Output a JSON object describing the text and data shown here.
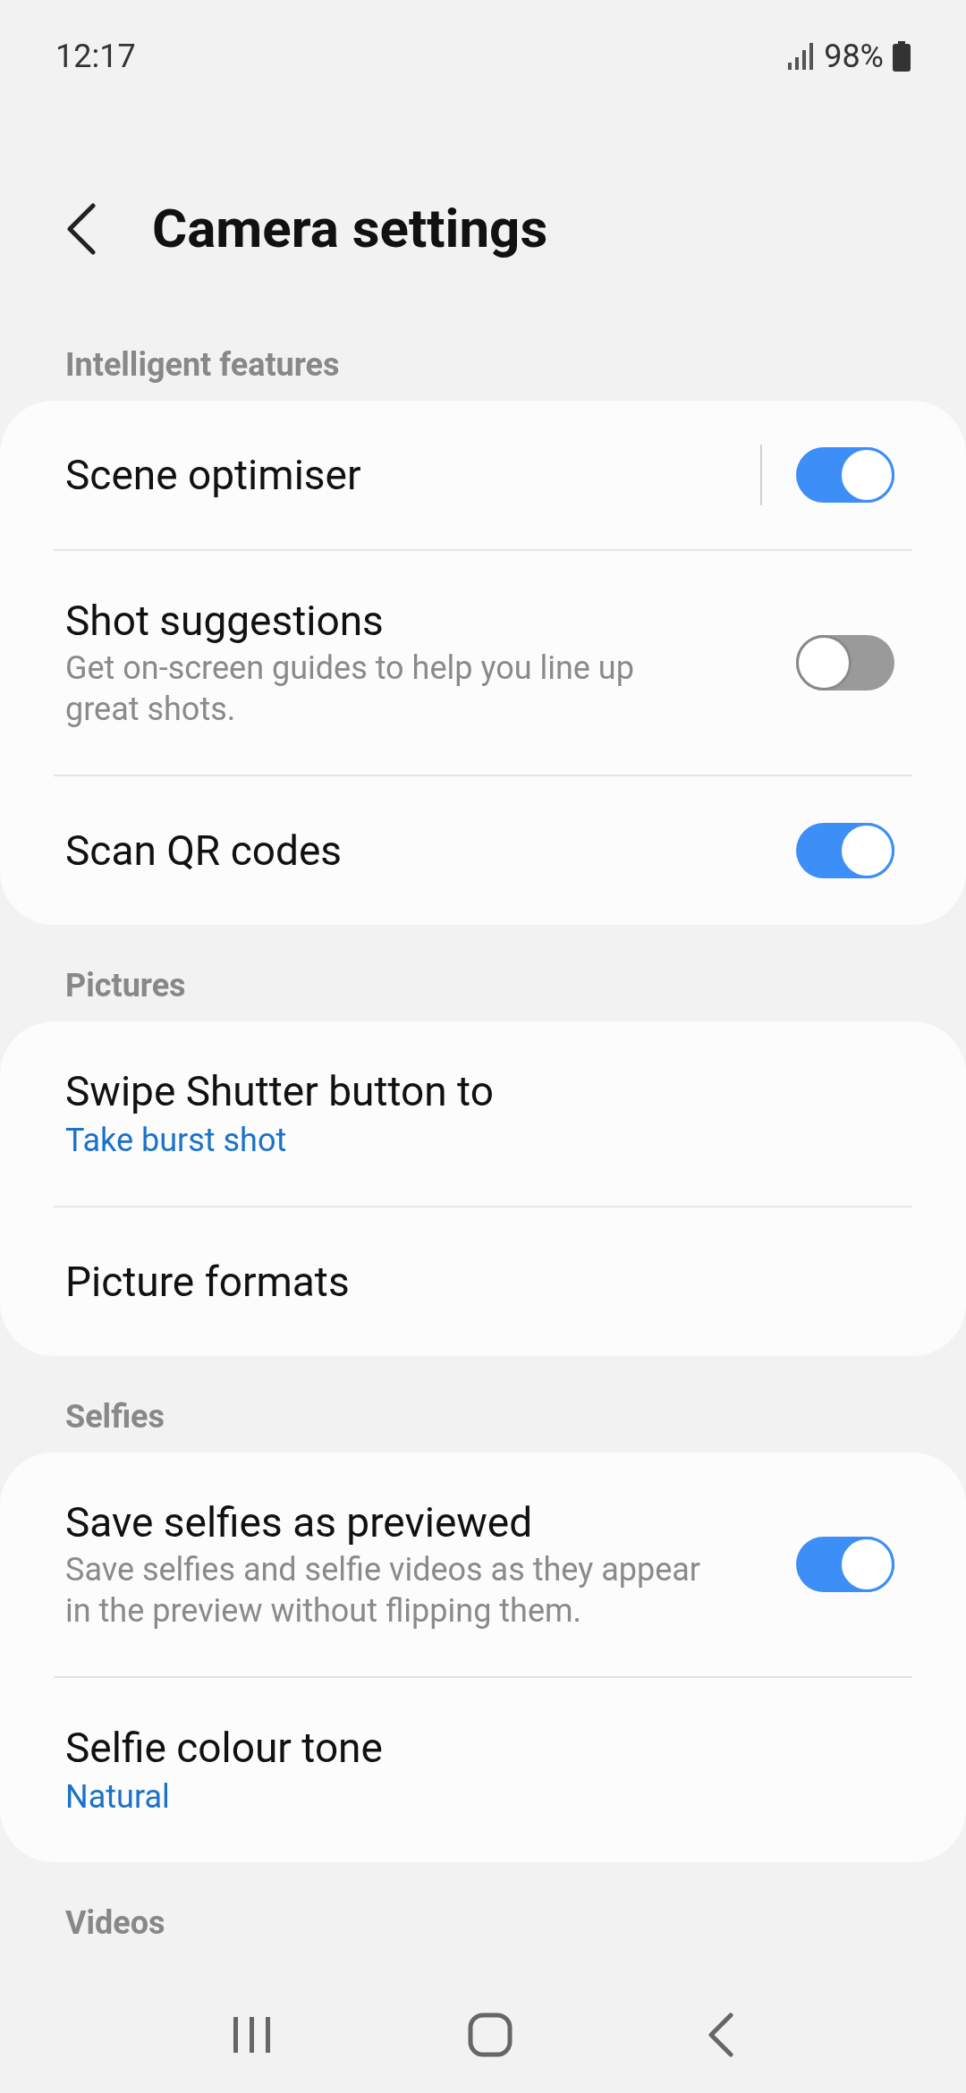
{
  "status_bar": {
    "time": "12:17",
    "battery": "98%"
  },
  "header": {
    "title": "Camera settings"
  },
  "sections": [
    {
      "title": "Intelligent features",
      "items": [
        {
          "kind": "split_toggle",
          "title": "Scene optimiser",
          "on": true
        },
        {
          "kind": "toggle",
          "title": "Shot suggestions",
          "subtitle": "Get on-screen guides to help you line up great shots.",
          "on": false
        },
        {
          "kind": "toggle",
          "title": "Scan QR codes",
          "on": true
        }
      ]
    },
    {
      "title": "Pictures",
      "items": [
        {
          "kind": "value",
          "title": "Swipe Shutter button to",
          "value": "Take burst shot"
        },
        {
          "kind": "link",
          "title": "Picture formats"
        }
      ]
    },
    {
      "title": "Selfies",
      "items": [
        {
          "kind": "toggle",
          "title": "Save selfies as previewed",
          "subtitle": "Save selfies and selfie videos as they appear in the preview without flipping them.",
          "on": true
        },
        {
          "kind": "value",
          "title": "Selfie colour tone",
          "value": "Natural"
        }
      ]
    },
    {
      "title": "Videos"
    }
  ]
}
